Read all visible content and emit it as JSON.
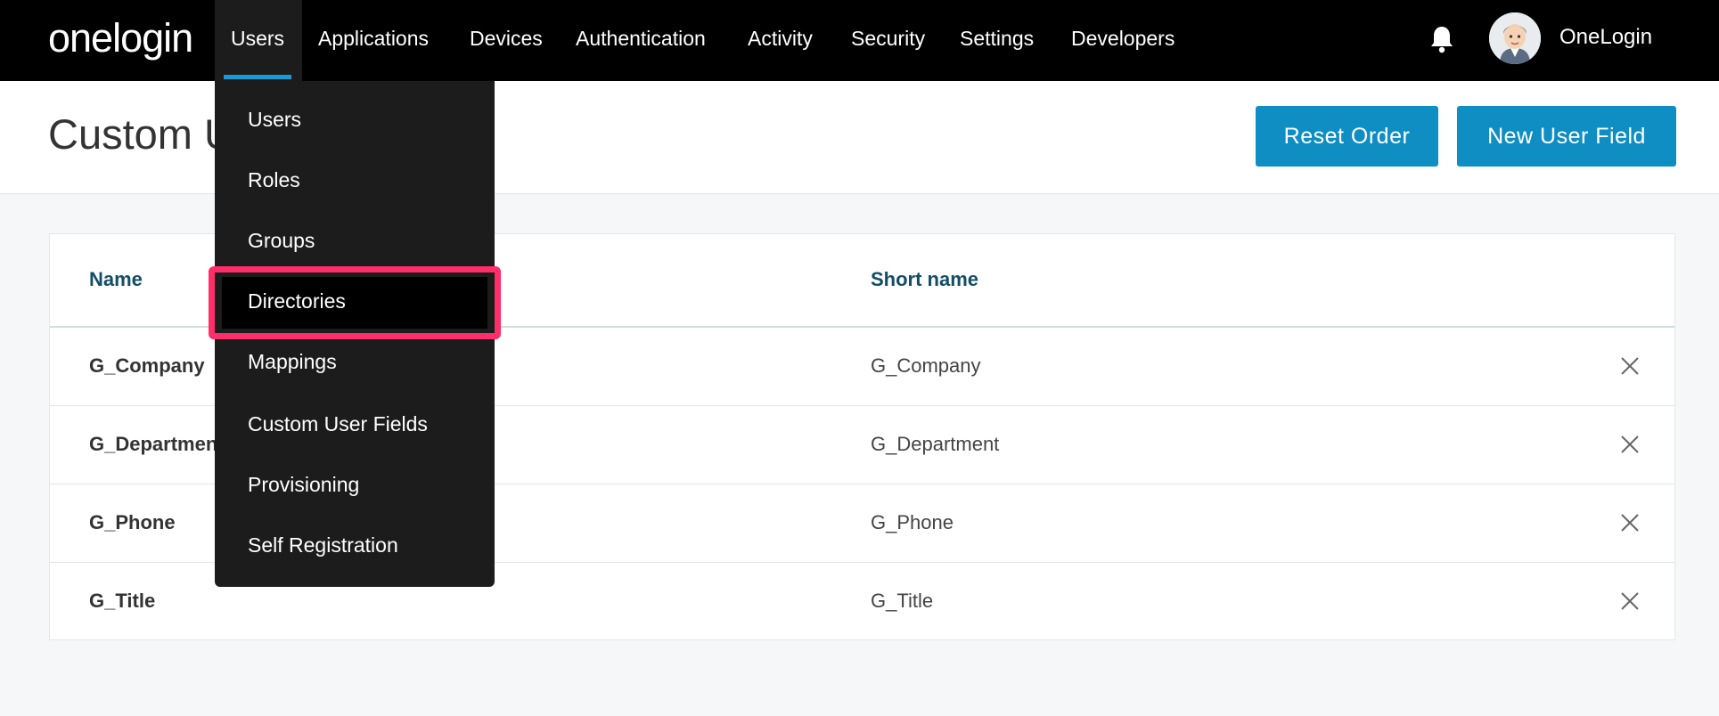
{
  "nav": {
    "logo": "onelogin",
    "items": [
      {
        "label": "Users"
      },
      {
        "label": "Applications"
      },
      {
        "label": "Devices"
      },
      {
        "label": "Authentication"
      },
      {
        "label": "Activity"
      },
      {
        "label": "Security"
      },
      {
        "label": "Settings"
      },
      {
        "label": "Developers"
      }
    ],
    "account_name": "OneLogin",
    "bell_icon": "bell-icon",
    "accent_color": "#1a9ad6"
  },
  "header": {
    "title": "Custom U",
    "reset_button": "Reset Order",
    "new_button": "New User Field",
    "button_color": "#0f8ec4"
  },
  "table": {
    "columns": {
      "name": "Name",
      "short_name": "Short name"
    },
    "rows": [
      {
        "name": "G_Company",
        "short_name": "G_Company"
      },
      {
        "name": "G_Departmen",
        "short_name": "G_Department"
      },
      {
        "name": "G_Phone",
        "short_name": "G_Phone"
      },
      {
        "name": "G_Title",
        "short_name": "G_Title"
      }
    ],
    "delete_icon": "close-icon"
  },
  "users_menu": {
    "items": [
      {
        "label": "Users"
      },
      {
        "label": "Roles"
      },
      {
        "label": "Groups"
      },
      {
        "label": "Directories"
      },
      {
        "label": "Mappings"
      },
      {
        "label": "Custom User Fields"
      },
      {
        "label": "Provisioning"
      },
      {
        "label": "Self Registration"
      }
    ],
    "highlighted_item": "Directories",
    "highlight_color": "#ff2e6a"
  }
}
